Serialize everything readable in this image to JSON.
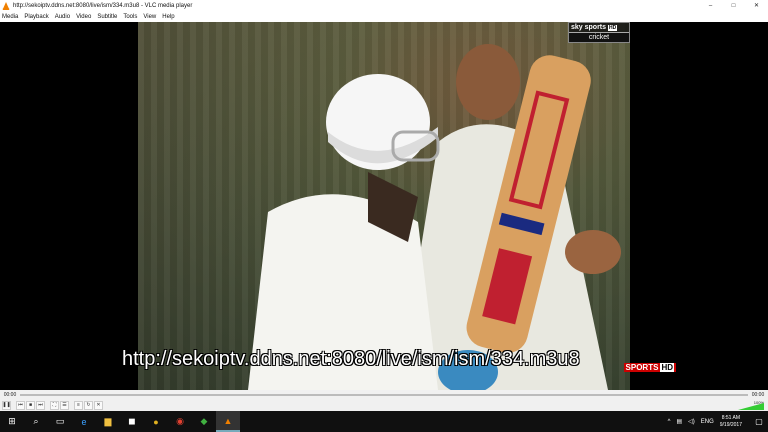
{
  "window": {
    "title": "http://sekoiptv.ddns.net:8080/live/ism/334.m3u8 - VLC media player",
    "minimize": "–",
    "maximize": "□",
    "close": "✕"
  },
  "menu": [
    "Media",
    "Playback",
    "Audio",
    "Video",
    "Subtitle",
    "Tools",
    "View",
    "Help"
  ],
  "video": {
    "watermark_brand": "sky sports",
    "watermark_hd": "HD",
    "watermark_channel": "cricket",
    "subtitle_text": "http://sekoiptv.ddns.net:8080/live/ism/ism/334.m3u8",
    "channel_logo": "SPORTS",
    "channel_logo_hd": "HD"
  },
  "seek": {
    "elapsed": "00:00",
    "total": "00:00"
  },
  "controls": {
    "play_pause": "❚❚",
    "prev": "⏮",
    "stop": "■",
    "next": "⏭",
    "fullscreen": "⛶",
    "extended": "☰",
    "playlist": "≡",
    "loop": "↻",
    "random": "✕",
    "volume_pct": "100%"
  },
  "taskbar": {
    "start": "⊞",
    "search": "⌕",
    "taskview": "▭",
    "edge": "e",
    "explorer": "▆",
    "store": "◼",
    "app_yellow": "●",
    "chrome": "◉",
    "app_green": "◆",
    "vlc": "▲",
    "tray_up": "^",
    "network": "▤",
    "speaker": "◁)",
    "language": "ENG",
    "time": "8:51 AM",
    "date": "9/19/2017",
    "notification": "▢"
  },
  "colors": {
    "vlc_orange": "#f08000",
    "volume_green": "#33cc33"
  }
}
